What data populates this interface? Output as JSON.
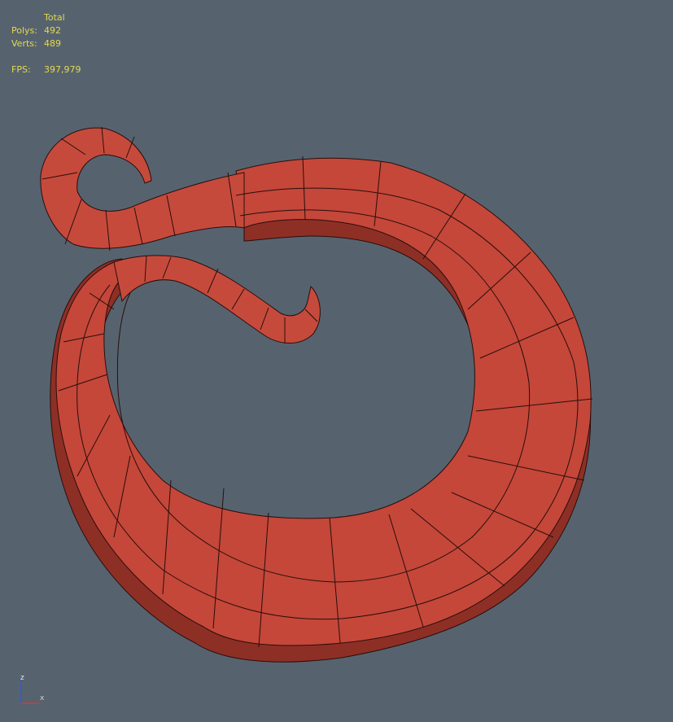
{
  "stats": {
    "header": "Total",
    "polys_label": "Polys:",
    "polys_value": "492",
    "verts_label": "Verts:",
    "verts_value": "489",
    "fps_label": "FPS:",
    "fps_value": "397,979"
  },
  "axis": {
    "z_label": "z",
    "x_label": "x"
  },
  "colors": {
    "background": "#56636f",
    "stats_text": "#e6d84c",
    "mesh_fill": "#c4473a",
    "mesh_shadow": "#8e2f26",
    "wire": "#2a0e0b",
    "axis_z": "#3a55d0",
    "axis_x": "#d03a3a"
  }
}
